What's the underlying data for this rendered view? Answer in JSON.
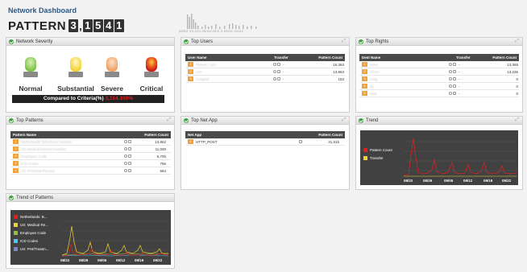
{
  "header": {
    "title": "Network Dashboard",
    "pattern_word": "PATTERN",
    "pattern_digits": [
      "3",
      "1",
      "5",
      "4",
      "1"
    ],
    "spark_axis": "ARE2 09.224 09/04 09/2.3 09/31 09/22"
  },
  "severity_panel": {
    "title": "Network Severity",
    "levels": [
      {
        "label": "Normal",
        "color": "#7cc243"
      },
      {
        "label": "Substantial",
        "color": "#f2d232"
      },
      {
        "label": "Severe",
        "color": "#f0a060"
      },
      {
        "label": "Critical",
        "color": "#e8302a"
      }
    ],
    "criteria_label": "Compared to Criteria(%)",
    "criteria_value": "3,154.100%"
  },
  "top_users": {
    "title": "Top Users",
    "columns": [
      "User Name",
      "Transfer",
      "Pattern Count"
    ],
    "rows": [
      {
        "rank": "1",
        "name": "Patient Care",
        "transfer": "-",
        "count": "16,363"
      },
      {
        "rank": "2",
        "name": "Ann",
        "transfer": "-",
        "count": "13,863"
      },
      {
        "rank": "3",
        "name": "Hospital",
        "transfer": "-",
        "count": "153"
      }
    ]
  },
  "top_rights": {
    "title": "Top Rights",
    "columns": [
      "Dest Name",
      "Transfer",
      "Pattern Count"
    ],
    "rows": [
      {
        "rank": "1",
        "name": "www",
        "transfer": "-",
        "count": "13,365"
      },
      {
        "rank": "2",
        "name": "Direct",
        "transfer": "-",
        "count": "13,236"
      },
      {
        "rank": "3",
        "name": "smtp",
        "transfer": "-",
        "count": "0"
      },
      {
        "rank": "4",
        "name": "ftp",
        "transfer": "-",
        "count": "0"
      },
      {
        "rank": "5",
        "name": "smb",
        "transfer": "-",
        "count": "0"
      }
    ]
  },
  "top_patterns": {
    "title": "Top Patterns",
    "columns": [
      "Pattern Name",
      "Pattern Count"
    ],
    "rows": [
      {
        "rank": "1",
        "name": "Netherlands Telephone Number",
        "count": "13,862"
      },
      {
        "rank": "2",
        "name": "US Medical Record Number",
        "count": "11,000"
      },
      {
        "rank": "3",
        "name": "Employee Code",
        "count": "5,700"
      },
      {
        "rank": "4",
        "name": "ICD Codes",
        "count": "756"
      },
      {
        "rank": "5",
        "name": "US PHI/Deal Record",
        "count": "584"
      }
    ]
  },
  "top_net_app": {
    "title": "Top Net App",
    "columns": [
      "Net App",
      "Pattern Count"
    ],
    "rows": [
      {
        "rank": "1",
        "name": "HTTP_POST",
        "count": "31,515"
      }
    ]
  },
  "trend": {
    "title": "Trend",
    "legend": [
      {
        "name": "Pattern Count",
        "color": "#e02020"
      },
      {
        "name": "Transfer",
        "color": "#f2d232"
      }
    ],
    "ticks": [
      "08/22",
      "08/29",
      "09/05",
      "09/12",
      "09/19",
      "09/22"
    ]
  },
  "trend_patterns": {
    "title": "Trend of Patterns",
    "legend": [
      {
        "name": "Netherlands: B...",
        "color": "#e02020"
      },
      {
        "name": "US: Medical Re...",
        "color": "#f2d232"
      },
      {
        "name": "Employee Code",
        "color": "#8bc34a"
      },
      {
        "name": "ICD Codes",
        "color": "#4fc3f7"
      },
      {
        "name": "US: PHI/Treatm...",
        "color": "#7986cb"
      }
    ],
    "ticks": [
      "08/22",
      "08/29",
      "09/05",
      "09/12",
      "09/19",
      "09/22"
    ]
  }
}
